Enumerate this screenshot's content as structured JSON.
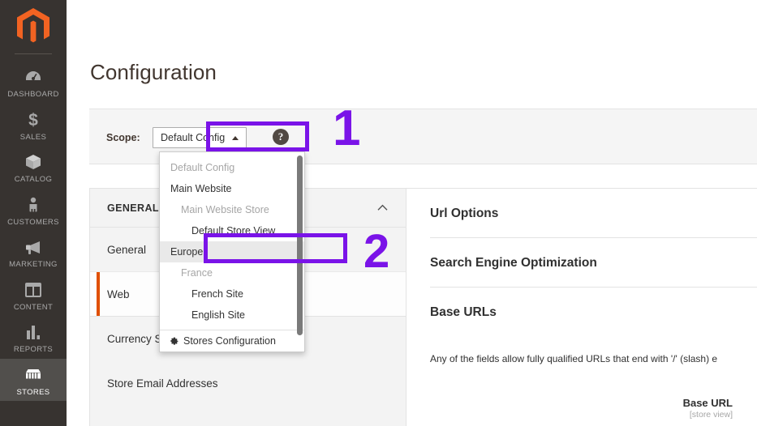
{
  "sidebar": {
    "logo_name": "magento-logo",
    "items": [
      {
        "label": "DASHBOARD",
        "icon": "dashboard-icon",
        "active": false
      },
      {
        "label": "SALES",
        "icon": "dollar-icon",
        "active": false
      },
      {
        "label": "CATALOG",
        "icon": "box-icon",
        "active": false
      },
      {
        "label": "CUSTOMERS",
        "icon": "person-icon",
        "active": false
      },
      {
        "label": "MARKETING",
        "icon": "megaphone-icon",
        "active": false
      },
      {
        "label": "CONTENT",
        "icon": "layout-icon",
        "active": false
      },
      {
        "label": "REPORTS",
        "icon": "bar-chart-icon",
        "active": false
      },
      {
        "label": "STORES",
        "icon": "store-icon",
        "active": true
      }
    ]
  },
  "header": {
    "page_title": "Configuration"
  },
  "scope": {
    "label": "Scope:",
    "selected": "Default Config",
    "caret_icon": "caret-up-icon",
    "help_icon": "question-mark-icon",
    "help_text": "?"
  },
  "scope_dropdown": {
    "open": true,
    "items": [
      {
        "label": "Default Config",
        "level": "website",
        "type": "group",
        "selected": false
      },
      {
        "label": "Main Website",
        "level": "website",
        "type": "item",
        "selected": false
      },
      {
        "label": "Main Website Store",
        "level": "store",
        "type": "group",
        "selected": false
      },
      {
        "label": "Default Store View",
        "level": "view",
        "type": "item",
        "selected": false
      },
      {
        "label": "Europe",
        "level": "website",
        "type": "item",
        "selected": true
      },
      {
        "label": "France",
        "level": "store",
        "type": "group",
        "selected": false
      },
      {
        "label": "French Site",
        "level": "view",
        "type": "item",
        "selected": false
      },
      {
        "label": "English Site",
        "level": "view",
        "type": "item",
        "selected": false
      }
    ],
    "footer": {
      "label": "Stores Configuration",
      "icon": "gear-icon"
    }
  },
  "annotations": [
    {
      "name": "step-1",
      "text": "1",
      "target": "scope-selector"
    },
    {
      "name": "step-2",
      "text": "2",
      "target": "europe-dropdown-item"
    }
  ],
  "config_nav": {
    "section_title": "GENERAL",
    "collapse_icon": "chevron-up-icon",
    "items": [
      {
        "label": "General",
        "active": false
      },
      {
        "label": "Web",
        "active": true
      },
      {
        "label": "Currency Setup",
        "active": false
      },
      {
        "label": "Store Email Addresses",
        "active": false
      }
    ]
  },
  "config_content": {
    "sections": [
      {
        "label": "Url Options"
      },
      {
        "label": "Search Engine Optimization"
      },
      {
        "label": "Base URLs"
      }
    ],
    "note": "Any of the fields allow fully qualified URLs that end with '/' (slash) e",
    "field": {
      "name": "Base URL",
      "scope": "[store view]"
    }
  },
  "colors": {
    "accent_purple": "#7a13e8",
    "sidebar_bg": "#373330",
    "active_orange": "#e04f00",
    "magento_orange": "#f26322"
  }
}
